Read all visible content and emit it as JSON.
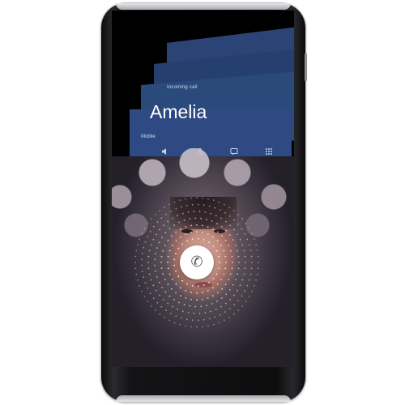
{
  "incoming_call": {
    "label": "Incoming call",
    "caller_name": "Amelia",
    "caller_detail": "Mobile",
    "actions": [
      {
        "icon": "speaker-icon"
      },
      {
        "icon": "mute-icon"
      },
      {
        "icon": "message-icon"
      },
      {
        "icon": "keypad-icon"
      }
    ],
    "answer_icon": "phone-icon",
    "answer_glyph": "✆"
  },
  "colors": {
    "card_blue": "#2f4a82",
    "card_blue_dark": "#25406e",
    "answer_button": "#ffffff",
    "ring_dots": "#f2e9e6"
  }
}
